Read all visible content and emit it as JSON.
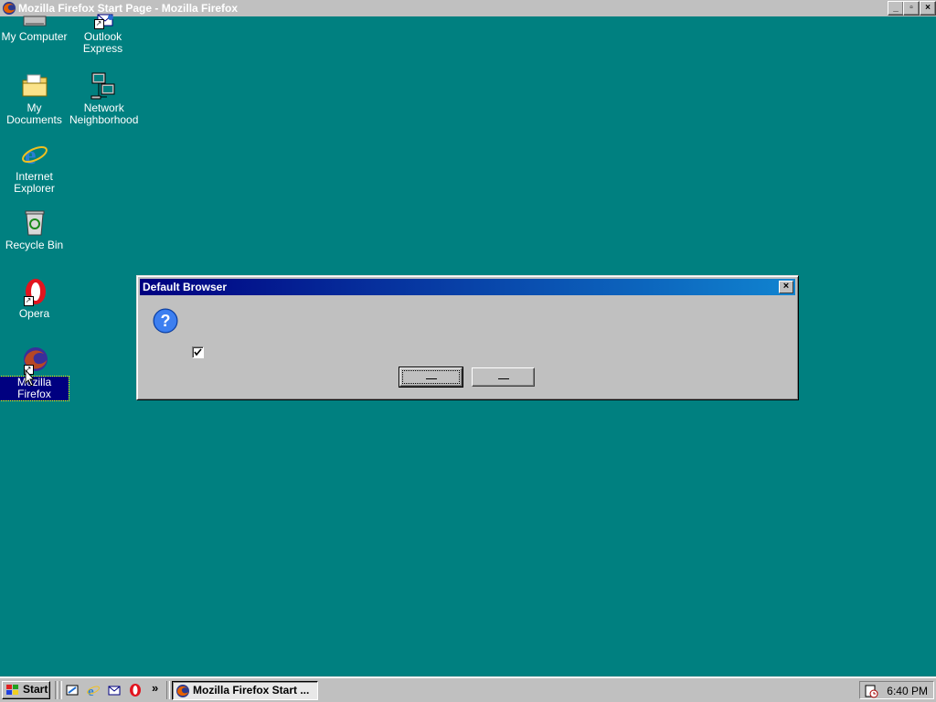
{
  "window": {
    "title": "Mozilla Firefox Start Page - Mozilla Firefox",
    "buttons": [
      "_",
      "▫",
      "×"
    ]
  },
  "desktop": {
    "icons": [
      {
        "label": "My Computer"
      },
      {
        "label": "Outlook Express"
      },
      {
        "label": "My Documents"
      },
      {
        "label": "Network Neighborhood"
      },
      {
        "label": "Internet Explorer"
      },
      {
        "label": "Recycle Bin"
      },
      {
        "label": "Opera"
      },
      {
        "label": "Mozilla Firefox"
      }
    ]
  },
  "dialog": {
    "title": "Default Browser",
    "checkbox_checked": true,
    "buttons": [
      {
        "label": "",
        "default": true
      },
      {
        "label": ""
      }
    ]
  },
  "taskbar": {
    "start_label": "Start",
    "task_label": "Mozilla Firefox Start ...",
    "more": "»",
    "clock": "6:40 PM"
  },
  "colors": {
    "desktop": "#008080",
    "title_active": "#000080",
    "title_inactive": "#c0c0c0",
    "face": "#c0c0c0"
  }
}
